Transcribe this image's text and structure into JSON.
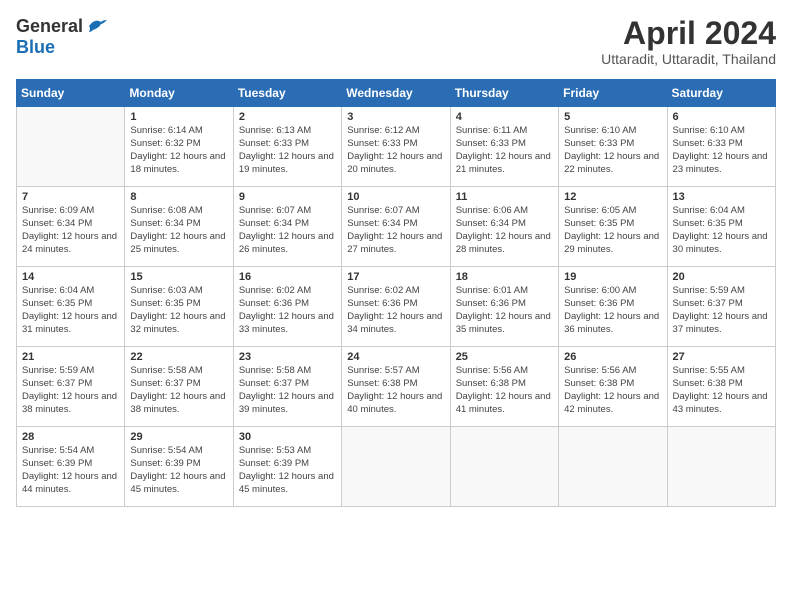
{
  "header": {
    "logo_general": "General",
    "logo_blue": "Blue",
    "month_title": "April 2024",
    "location": "Uttaradit, Uttaradit, Thailand"
  },
  "days_of_week": [
    "Sunday",
    "Monday",
    "Tuesday",
    "Wednesday",
    "Thursday",
    "Friday",
    "Saturday"
  ],
  "weeks": [
    [
      {
        "day": "",
        "info": ""
      },
      {
        "day": "1",
        "info": "Sunrise: 6:14 AM\nSunset: 6:32 PM\nDaylight: 12 hours\nand 18 minutes."
      },
      {
        "day": "2",
        "info": "Sunrise: 6:13 AM\nSunset: 6:33 PM\nDaylight: 12 hours\nand 19 minutes."
      },
      {
        "day": "3",
        "info": "Sunrise: 6:12 AM\nSunset: 6:33 PM\nDaylight: 12 hours\nand 20 minutes."
      },
      {
        "day": "4",
        "info": "Sunrise: 6:11 AM\nSunset: 6:33 PM\nDaylight: 12 hours\nand 21 minutes."
      },
      {
        "day": "5",
        "info": "Sunrise: 6:10 AM\nSunset: 6:33 PM\nDaylight: 12 hours\nand 22 minutes."
      },
      {
        "day": "6",
        "info": "Sunrise: 6:10 AM\nSunset: 6:33 PM\nDaylight: 12 hours\nand 23 minutes."
      }
    ],
    [
      {
        "day": "7",
        "info": "Sunrise: 6:09 AM\nSunset: 6:34 PM\nDaylight: 12 hours\nand 24 minutes."
      },
      {
        "day": "8",
        "info": "Sunrise: 6:08 AM\nSunset: 6:34 PM\nDaylight: 12 hours\nand 25 minutes."
      },
      {
        "day": "9",
        "info": "Sunrise: 6:07 AM\nSunset: 6:34 PM\nDaylight: 12 hours\nand 26 minutes."
      },
      {
        "day": "10",
        "info": "Sunrise: 6:07 AM\nSunset: 6:34 PM\nDaylight: 12 hours\nand 27 minutes."
      },
      {
        "day": "11",
        "info": "Sunrise: 6:06 AM\nSunset: 6:34 PM\nDaylight: 12 hours\nand 28 minutes."
      },
      {
        "day": "12",
        "info": "Sunrise: 6:05 AM\nSunset: 6:35 PM\nDaylight: 12 hours\nand 29 minutes."
      },
      {
        "day": "13",
        "info": "Sunrise: 6:04 AM\nSunset: 6:35 PM\nDaylight: 12 hours\nand 30 minutes."
      }
    ],
    [
      {
        "day": "14",
        "info": "Sunrise: 6:04 AM\nSunset: 6:35 PM\nDaylight: 12 hours\nand 31 minutes."
      },
      {
        "day": "15",
        "info": "Sunrise: 6:03 AM\nSunset: 6:35 PM\nDaylight: 12 hours\nand 32 minutes."
      },
      {
        "day": "16",
        "info": "Sunrise: 6:02 AM\nSunset: 6:36 PM\nDaylight: 12 hours\nand 33 minutes."
      },
      {
        "day": "17",
        "info": "Sunrise: 6:02 AM\nSunset: 6:36 PM\nDaylight: 12 hours\nand 34 minutes."
      },
      {
        "day": "18",
        "info": "Sunrise: 6:01 AM\nSunset: 6:36 PM\nDaylight: 12 hours\nand 35 minutes."
      },
      {
        "day": "19",
        "info": "Sunrise: 6:00 AM\nSunset: 6:36 PM\nDaylight: 12 hours\nand 36 minutes."
      },
      {
        "day": "20",
        "info": "Sunrise: 5:59 AM\nSunset: 6:37 PM\nDaylight: 12 hours\nand 37 minutes."
      }
    ],
    [
      {
        "day": "21",
        "info": "Sunrise: 5:59 AM\nSunset: 6:37 PM\nDaylight: 12 hours\nand 38 minutes."
      },
      {
        "day": "22",
        "info": "Sunrise: 5:58 AM\nSunset: 6:37 PM\nDaylight: 12 hours\nand 38 minutes."
      },
      {
        "day": "23",
        "info": "Sunrise: 5:58 AM\nSunset: 6:37 PM\nDaylight: 12 hours\nand 39 minutes."
      },
      {
        "day": "24",
        "info": "Sunrise: 5:57 AM\nSunset: 6:38 PM\nDaylight: 12 hours\nand 40 minutes."
      },
      {
        "day": "25",
        "info": "Sunrise: 5:56 AM\nSunset: 6:38 PM\nDaylight: 12 hours\nand 41 minutes."
      },
      {
        "day": "26",
        "info": "Sunrise: 5:56 AM\nSunset: 6:38 PM\nDaylight: 12 hours\nand 42 minutes."
      },
      {
        "day": "27",
        "info": "Sunrise: 5:55 AM\nSunset: 6:38 PM\nDaylight: 12 hours\nand 43 minutes."
      }
    ],
    [
      {
        "day": "28",
        "info": "Sunrise: 5:54 AM\nSunset: 6:39 PM\nDaylight: 12 hours\nand 44 minutes."
      },
      {
        "day": "29",
        "info": "Sunrise: 5:54 AM\nSunset: 6:39 PM\nDaylight: 12 hours\nand 45 minutes."
      },
      {
        "day": "30",
        "info": "Sunrise: 5:53 AM\nSunset: 6:39 PM\nDaylight: 12 hours\nand 45 minutes."
      },
      {
        "day": "",
        "info": ""
      },
      {
        "day": "",
        "info": ""
      },
      {
        "day": "",
        "info": ""
      },
      {
        "day": "",
        "info": ""
      }
    ]
  ]
}
